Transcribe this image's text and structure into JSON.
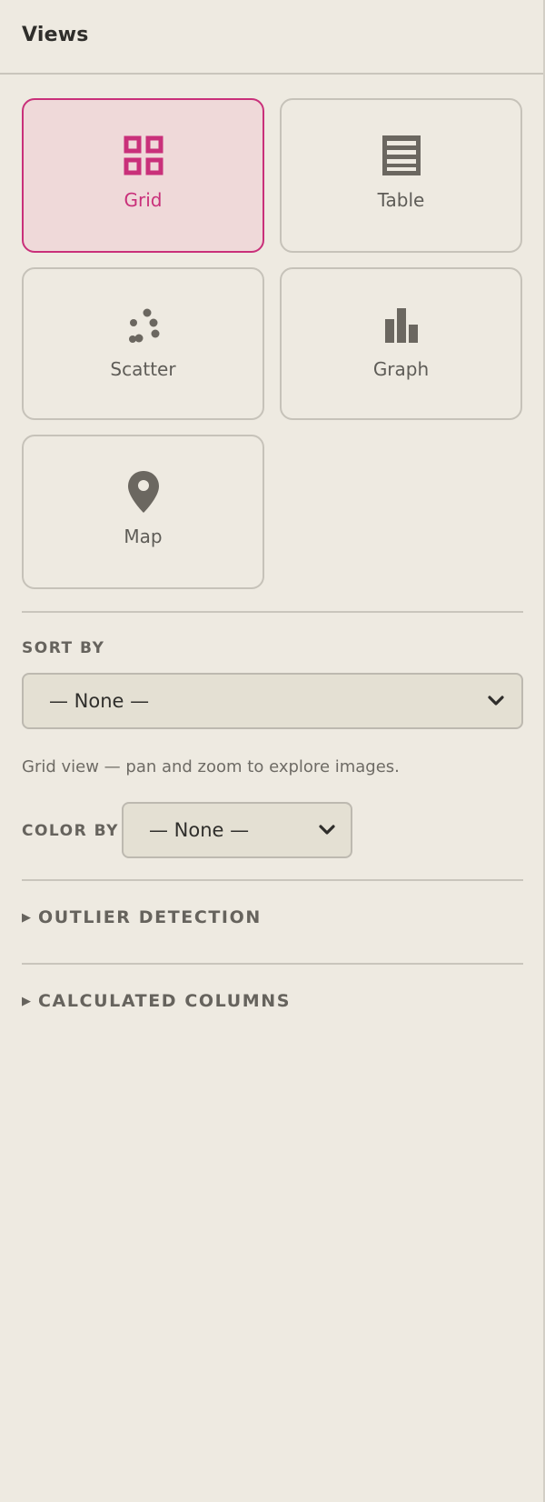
{
  "panel": {
    "title": "Views"
  },
  "views": [
    {
      "label": "Grid",
      "icon": "grid-icon",
      "active": true
    },
    {
      "label": "Table",
      "icon": "table-icon",
      "active": false
    },
    {
      "label": "Scatter",
      "icon": "scatter-icon",
      "active": false
    },
    {
      "label": "Graph",
      "icon": "bar-chart-icon",
      "active": false
    },
    {
      "label": "Map",
      "icon": "map-pin-icon",
      "active": false
    }
  ],
  "sort": {
    "label": "SORT BY",
    "selected": "— None —"
  },
  "hint_text": "Grid view — pan and zoom to explore images.",
  "color": {
    "label": "COLOR BY",
    "selected": "— None —"
  },
  "sections": {
    "outlier": "OUTLIER DETECTION",
    "calculated": "CALCULATED COLUMNS",
    "toggle_glyph": "▶"
  },
  "colors": {
    "accent": "#c9307a",
    "active_bg": "#efd9d9",
    "background": "#eeeae1",
    "icon": "#6b6760"
  }
}
